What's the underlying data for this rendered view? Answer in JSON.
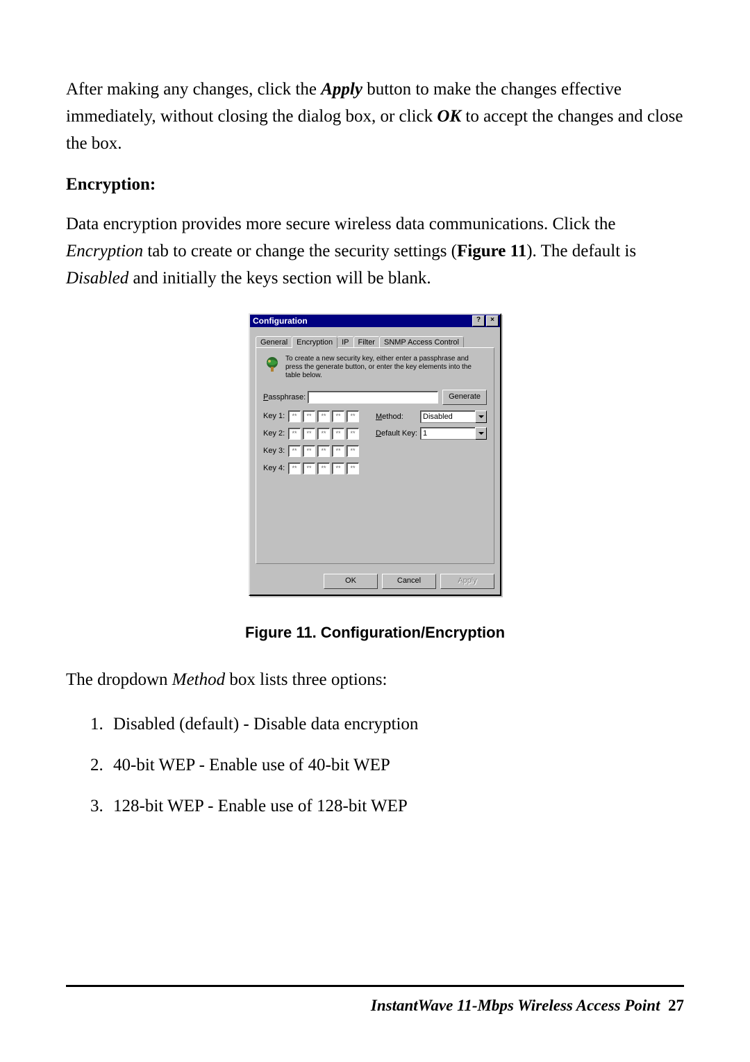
{
  "intro_paragraph_parts": {
    "p1a": "After making any changes, click the ",
    "apply": "Apply",
    "p1b": " button to make the changes effective immediately, without closing the dialog box, or click ",
    "ok": "OK",
    "p1c": " to accept the changes and close the box."
  },
  "section_heading": "Encryption:",
  "enc_paragraph": {
    "a": "Data encryption provides more secure wireless data communications. Click the ",
    "enc_tab": "Encryption",
    "b": " tab to create or change the security settings (",
    "figref": "Figure 11",
    "c": "). The default is ",
    "disabled": "Disabled",
    "d": " and initially the keys section will be blank."
  },
  "dialog": {
    "title": "Configuration",
    "help_btn": "?",
    "close_btn": "×",
    "tabs": [
      "General",
      "Encryption",
      "IP",
      "Filter",
      "SNMP Access Control"
    ],
    "active_tab_index": 1,
    "instructions": "To create a new security key, either enter a passphrase and press the generate button, or enter the key elements into the table below.",
    "passphrase_label": "Passphrase:",
    "passphrase_value": "",
    "generate_btn": "Generate",
    "key_labels": [
      "Key 1:",
      "Key 2:",
      "Key 3:",
      "Key 4:"
    ],
    "key_cell_placeholder": "**",
    "method_label": "Method:",
    "method_value": "Disabled",
    "default_key_label": "Default Key:",
    "default_key_value": "1",
    "ok_btn": "OK",
    "cancel_btn": "Cancel",
    "apply_btn": "Apply"
  },
  "caption": "Figure 11.  Configuration/Encryption",
  "method_intro": "The dropdown Method box lists three options:",
  "method_intro_parts": {
    "a": "The dropdown ",
    "m": "Method",
    "b": " box lists three options:"
  },
  "methods": [
    "Disabled (default) - Disable data encryption",
    "40-bit WEP - Enable use of 40-bit WEP",
    "128-bit WEP - Enable use of 128-bit WEP"
  ],
  "footer": {
    "product": "InstantWave 11-Mbps Wireless Access Point",
    "page": "27"
  }
}
